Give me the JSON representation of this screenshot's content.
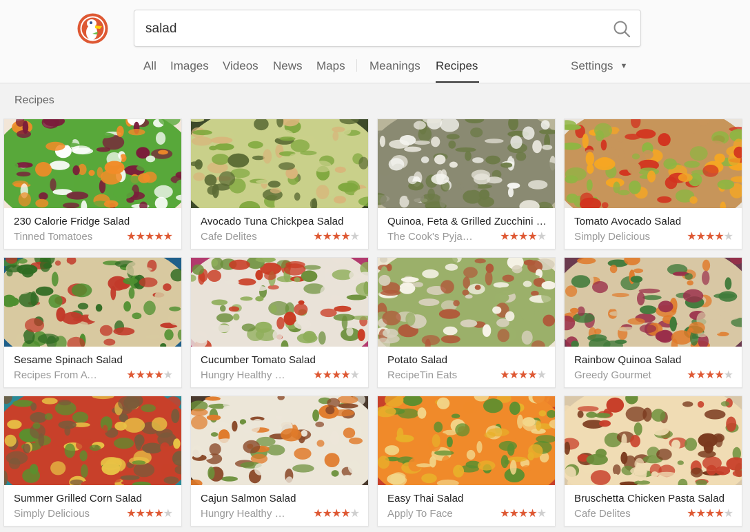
{
  "search": {
    "value": "salad"
  },
  "nav": {
    "tabs": [
      {
        "label": "All"
      },
      {
        "label": "Images"
      },
      {
        "label": "Videos"
      },
      {
        "label": "News"
      },
      {
        "label": "Maps"
      },
      {
        "label": "Meanings"
      },
      {
        "label": "Recipes"
      }
    ],
    "active": "Recipes",
    "settings_label": "Settings"
  },
  "section_label": "Recipes",
  "colors": {
    "accent": "#de5833",
    "star_off": "#cfcfcf"
  },
  "recipes": [
    {
      "title": "230 Calorie Fridge Salad",
      "source": "Tinned Tomatoes",
      "rating": 5,
      "palette": [
        "#f2e6d8",
        "#7a1c3a",
        "#f28c28",
        "#58a83a",
        "#ffffff"
      ]
    },
    {
      "title": "Avocado Tuna Chickpea Salad",
      "source": "Cafe Delites",
      "rating": 4,
      "palette": [
        "#3d4a2a",
        "#d9b57a",
        "#7fa83e",
        "#c9d08a",
        "#5b6b35"
      ]
    },
    {
      "title": "Quinoa, Feta & Grilled Zucchini Salad",
      "source": "The Cook's Pyjamas",
      "rating": 4,
      "palette": [
        "#b9b59a",
        "#e8e6dc",
        "#6b7a45",
        "#8a8a72",
        "#f4f4ef"
      ]
    },
    {
      "title": "Tomato Avocado Salad",
      "source": "Simply Delicious",
      "rating": 4,
      "palette": [
        "#e9e4dc",
        "#d2331f",
        "#8fb543",
        "#c7955a",
        "#f5a623"
      ]
    },
    {
      "title": "Sesame Spinach Salad",
      "source": "Recipes From A Pantry",
      "rating": 4,
      "palette": [
        "#1f5f8a",
        "#2f6b22",
        "#4e8f2f",
        "#d8c9a0",
        "#c23a2a"
      ]
    },
    {
      "title": "Cucumber Tomato Salad",
      "source": "Hungry Healthy Happy",
      "rating": 4,
      "palette": [
        "#b23a6e",
        "#c93a22",
        "#6b8f3a",
        "#e9e2d8",
        "#8fae5a"
      ]
    },
    {
      "title": "Potato Salad",
      "source": "RecipeTin Eats",
      "rating": 4,
      "palette": [
        "#ece6d4",
        "#f7f3e8",
        "#b05a3a",
        "#9bb06a",
        "#d7d0bc"
      ]
    },
    {
      "title": "Rainbow Quinoa Salad",
      "source": "Greedy Gourmet",
      "rating": 4,
      "palette": [
        "#6a3a4e",
        "#3f7a3a",
        "#e07a2a",
        "#d8c7a4",
        "#9a2f4a"
      ]
    },
    {
      "title": "Summer Grilled Corn Salad",
      "source": "Simply Delicious",
      "rating": 4,
      "palette": [
        "#2a8a96",
        "#e8c245",
        "#7a5a3a",
        "#c8402a",
        "#5b8f2f"
      ]
    },
    {
      "title": "Cajun Salmon Salad",
      "source": "Hungry Healthy Happy",
      "rating": 4,
      "palette": [
        "#4a3a2e",
        "#e07a2a",
        "#8a4a2a",
        "#ece6d8",
        "#6b8f3a"
      ]
    },
    {
      "title": "Easy Thai Salad",
      "source": "Apply To Face",
      "rating": 4,
      "palette": [
        "#c8402a",
        "#e8b02a",
        "#5b8f2f",
        "#f08a2a",
        "#f2d68a"
      ]
    },
    {
      "title": "Bruschetta Chicken Pasta Salad",
      "source": "Cafe Delites",
      "rating": 4,
      "palette": [
        "#d9c7a8",
        "#7a3a1e",
        "#c8402a",
        "#f0dcb4",
        "#6b8f3a"
      ]
    }
  ]
}
